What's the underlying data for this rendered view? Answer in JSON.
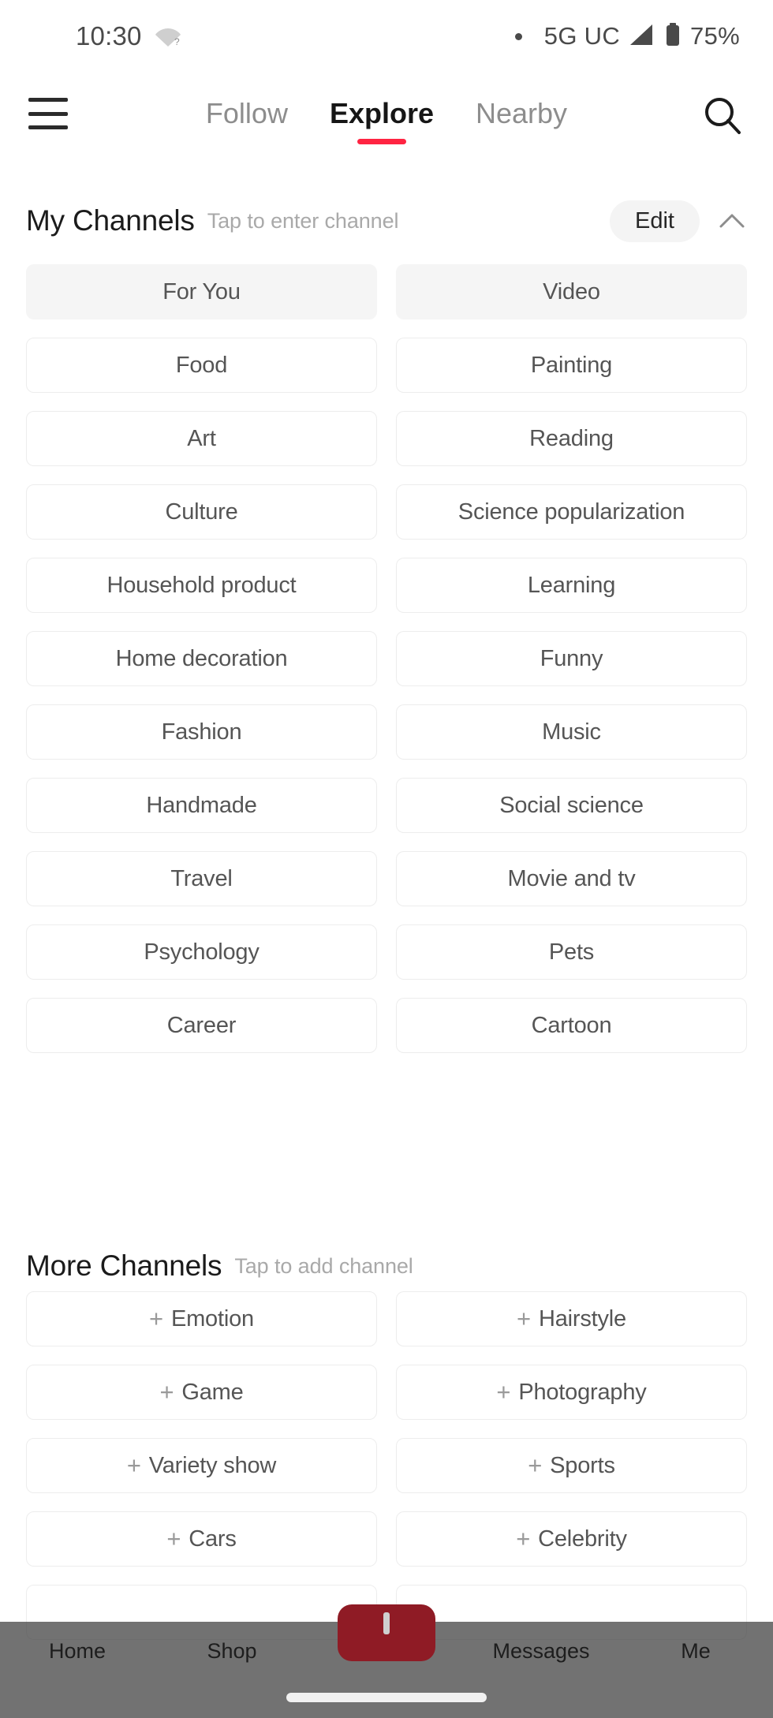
{
  "status_bar": {
    "time": "10:30",
    "wifi_icon": "wifi-question-icon",
    "privacy_dot": "•",
    "network": "5G UC",
    "signal_icon": "signal-bars-icon",
    "battery_icon": "battery-icon",
    "battery_percent": "75%"
  },
  "top_nav": {
    "menu_icon": "hamburger-menu-icon",
    "search_icon": "search-icon",
    "tabs": [
      {
        "label": "Follow",
        "active": false
      },
      {
        "label": "Explore",
        "active": true
      },
      {
        "label": "Nearby",
        "active": false
      }
    ],
    "accent_color": "#ff2442"
  },
  "my_channels": {
    "title": "My Channels",
    "subtitle": "Tap to enter channel",
    "edit_label": "Edit",
    "collapse_icon": "chevron-up-icon",
    "chips": [
      {
        "label": "For You",
        "filled": true
      },
      {
        "label": "Video",
        "filled": true
      },
      {
        "label": "Food",
        "filled": false
      },
      {
        "label": "Painting",
        "filled": false
      },
      {
        "label": "Art",
        "filled": false
      },
      {
        "label": "Reading",
        "filled": false
      },
      {
        "label": "Culture",
        "filled": false
      },
      {
        "label": "Science popularization",
        "filled": false
      },
      {
        "label": "Household product",
        "filled": false
      },
      {
        "label": "Learning",
        "filled": false
      },
      {
        "label": "Home decoration",
        "filled": false
      },
      {
        "label": "Funny",
        "filled": false
      },
      {
        "label": "Fashion",
        "filled": false
      },
      {
        "label": "Music",
        "filled": false
      },
      {
        "label": "Handmade",
        "filled": false
      },
      {
        "label": "Social science",
        "filled": false
      },
      {
        "label": "Travel",
        "filled": false
      },
      {
        "label": "Movie and tv",
        "filled": false
      },
      {
        "label": "Psychology",
        "filled": false
      },
      {
        "label": "Pets",
        "filled": false
      },
      {
        "label": "Career",
        "filled": false
      },
      {
        "label": "Cartoon",
        "filled": false
      }
    ]
  },
  "more_channels": {
    "title": "More Channels",
    "subtitle": "Tap to add channel",
    "add_symbol": "+",
    "chips": [
      {
        "label": "Emotion"
      },
      {
        "label": "Hairstyle"
      },
      {
        "label": "Game"
      },
      {
        "label": "Photography"
      },
      {
        "label": "Variety show"
      },
      {
        "label": "Sports"
      },
      {
        "label": "Cars"
      },
      {
        "label": "Celebrity"
      },
      {
        "label": ""
      },
      {
        "label": ""
      }
    ]
  },
  "bottom_nav": {
    "items": [
      {
        "label": "Home"
      },
      {
        "label": "Shop"
      },
      {
        "label": "Messages"
      },
      {
        "label": "Me"
      }
    ],
    "create_button_icon": "plus-create-icon",
    "create_button_color": "#8f1b25"
  }
}
